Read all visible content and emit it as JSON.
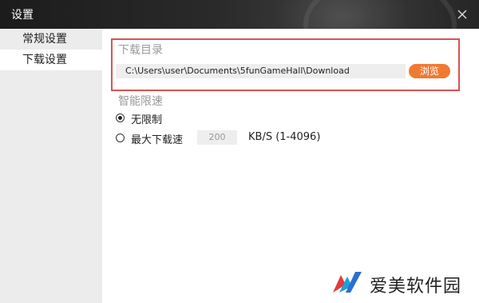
{
  "window": {
    "title": "设置",
    "close_icon": "close-icon"
  },
  "sidebar": {
    "items": [
      {
        "label": "常规设置",
        "active": false
      },
      {
        "label": "下载设置",
        "active": true
      }
    ]
  },
  "download_dir": {
    "section_label": "下载目录",
    "path_value": "C:\\Users\\user\\Documents\\5funGameHall\\Download",
    "browse_label": "浏览"
  },
  "speed_limit": {
    "section_label": "智能限速",
    "options": [
      {
        "label": "无限制",
        "checked": true
      },
      {
        "label": "最大下载速",
        "checked": false
      }
    ],
    "max_speed_value": "200",
    "unit_text": "KB/S (1-4096)"
  },
  "watermark": {
    "text": "爱美软件园"
  },
  "colors": {
    "accent": "#f07a32",
    "highlight_border": "#d9534f",
    "sidebar_bg": "#ececec",
    "titlebar_bg": "#2a2a2a"
  }
}
